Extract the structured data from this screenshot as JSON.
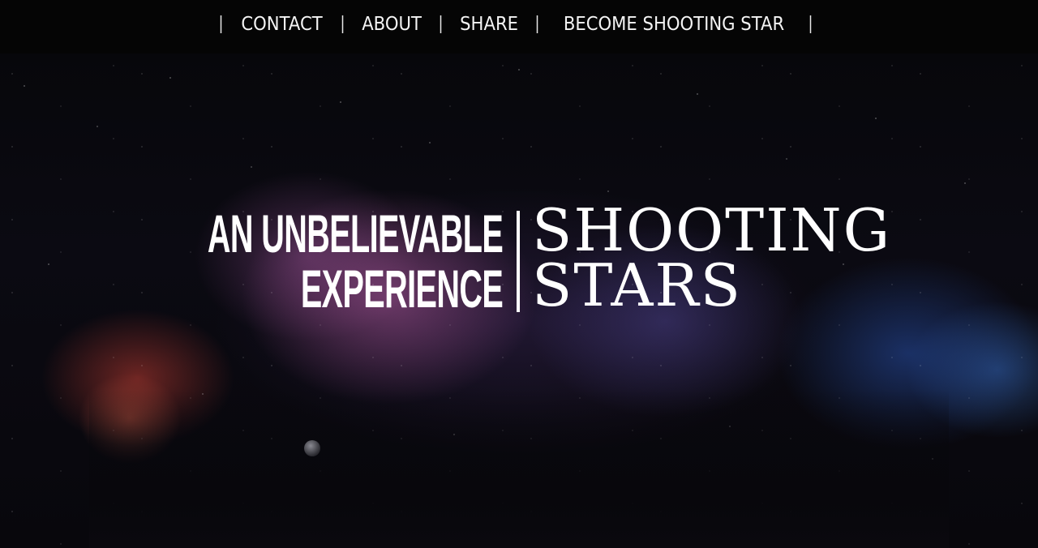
{
  "nav": {
    "items": [
      {
        "label": "CONTACT"
      },
      {
        "label": "ABOUT"
      },
      {
        "label": "SHARE"
      },
      {
        "label": "BECOME SHOOTING STAR"
      }
    ],
    "separator": "|"
  },
  "hero": {
    "tagline_line1": "AN UNBELIEVABLE",
    "tagline_line2": "EXPERIENCE",
    "brand_line1": "SHOOTING",
    "brand_line2": "STARS"
  },
  "colors": {
    "background": "#07060a",
    "text": "#ffffff"
  }
}
